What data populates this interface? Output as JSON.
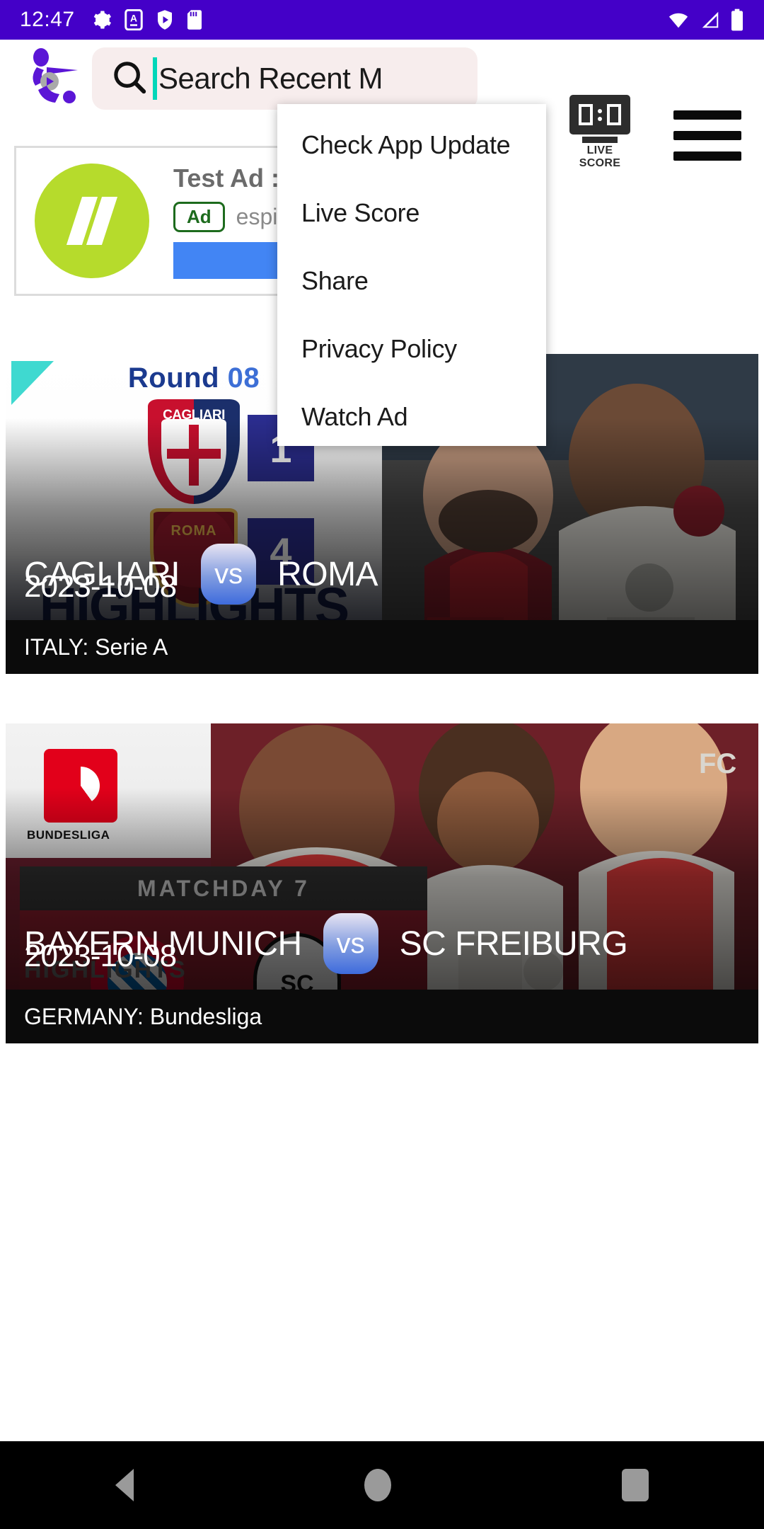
{
  "status_bar": {
    "time": "12:47",
    "left_icons": [
      "settings-icon",
      "app-notification-icon",
      "play-badge-icon",
      "sd-card-icon"
    ],
    "right_icons": [
      "wifi-icon",
      "signal-icon",
      "battery-icon"
    ],
    "background_color": "#4400C8"
  },
  "app_bar": {
    "logo_name": "football-app-logo",
    "search": {
      "placeholder": "Search Recent M",
      "value": "",
      "icon": "search-icon"
    },
    "live_score": {
      "label": "LIVE SCORE",
      "icon": "scoreboard-icon"
    },
    "menu_button_icon": "hamburger-menu-icon"
  },
  "ad": {
    "title": "Test Ad : Ad",
    "badge": "Ad",
    "advertiser": "espierto",
    "cta_label": "",
    "icon": "chevron-double-right-icon"
  },
  "menu": {
    "items": [
      {
        "label": "Check App Update",
        "name": "menu-item-check-app-update"
      },
      {
        "label": "Live Score",
        "name": "menu-item-live-score"
      },
      {
        "label": "Share",
        "name": "menu-item-share"
      },
      {
        "label": "Privacy Policy",
        "name": "menu-item-privacy-policy"
      },
      {
        "label": "Watch Ad",
        "name": "menu-item-watch-ad"
      }
    ]
  },
  "matches": [
    {
      "round_prefix": "Round",
      "round_number": "08",
      "home_team": "CAGLIARI",
      "away_team": "ROMA",
      "home_score": "1",
      "away_score": "4",
      "vs_label": "vs",
      "date": "2023-10-08",
      "league": "ITALY: Serie A",
      "highlights_word": "HIGHLIGHTS",
      "home_crest_label": "CAGLIARI",
      "away_crest_label": "ROMA"
    },
    {
      "matchday_label": "MATCHDAY 7",
      "home_team": "BAYERN MUNICH",
      "away_team": "SC FREIBURG",
      "vs_label": "vs",
      "date": "2023-10-08",
      "league": "GERMANY: Bundesliga",
      "highlights_word": "HIGHLIGHTS",
      "competition_logo_caption": "BUNDESLIGA",
      "away_crest_label": "SC"
    }
  ],
  "nav_bar": {
    "back": "back-button",
    "home": "home-button",
    "recents": "recents-button"
  }
}
